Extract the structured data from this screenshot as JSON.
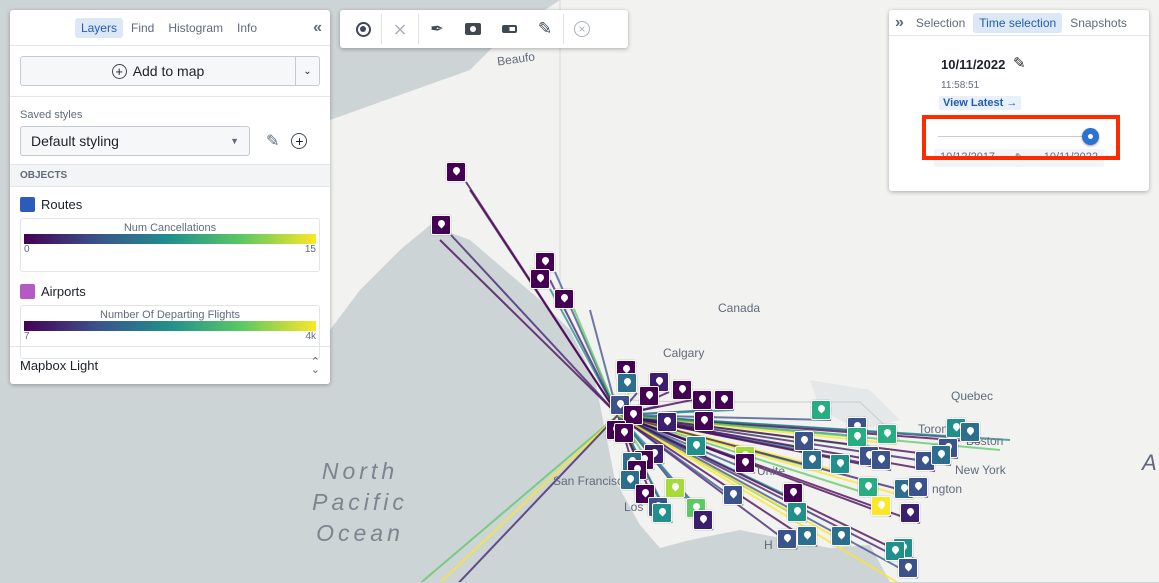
{
  "left_panel": {
    "tabs": [
      {
        "label": "Layers",
        "active": true
      },
      {
        "label": "Find"
      },
      {
        "label": "Histogram"
      },
      {
        "label": "Info"
      }
    ],
    "collapse_icon": "double-chevron-left",
    "add_to_map": "Add to map",
    "saved_styles_label": "Saved styles",
    "saved_style_value": "Default styling",
    "objects_header": "OBJECTS",
    "layers": [
      {
        "name": "Routes",
        "icon_color": "#2d5bb9",
        "legend_title": "Num Cancellations",
        "min": "0",
        "max": "15"
      },
      {
        "name": "Airports",
        "icon_color": "#b35ac4",
        "legend_title": "Number Of Departing Flights",
        "min": "7",
        "max": "4k"
      }
    ],
    "basemap": "Mapbox Light"
  },
  "toolbar": {
    "tools": [
      "target-icon",
      "graph-icon",
      "pen-icon",
      "camera-icon",
      "toggle-icon",
      "edit-icon",
      "clear-icon"
    ]
  },
  "right_panel": {
    "expand_icon": "double-chevron-right",
    "tabs": [
      {
        "label": "Selection"
      },
      {
        "label": "Time selection",
        "active": true
      },
      {
        "label": "Snapshots"
      }
    ],
    "date": "10/11/2022",
    "time": "11:58:51",
    "view_latest": "View Latest →",
    "slider_value": 1.0,
    "range_start": "10/12/2017",
    "range_end": "10/11/2022",
    "highlight_color": "#ff2a00"
  },
  "map": {
    "labels": {
      "beaufort": "Beaufo",
      "canada": "Canada",
      "calgary": "Calgary",
      "quebec": "Quebec",
      "toronto": "Toronto",
      "boston": "Boston",
      "newyork": "New York",
      "washington": "ngton",
      "sanfrancisco": "San Francisco",
      "losangeles": "Los",
      "atlantic": "A",
      "united": "Unite",
      "houston": "H",
      "ocean": "North Pacific Ocean"
    }
  }
}
